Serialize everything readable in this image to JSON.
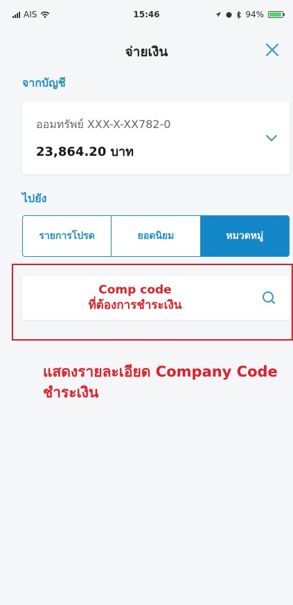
{
  "status_bar": {
    "carrier": "AIS",
    "time": "15:46",
    "battery": "94%",
    "battery_level": 0.94
  },
  "header": {
    "title": "จ่ายเงิน"
  },
  "from_section": {
    "label": "จากบัญชี",
    "account_name": "ออมทรัพย์ XXX-X-XX782-0",
    "balance": "23,864.20 บาท"
  },
  "to_section": {
    "label": "ไปยัง",
    "tabs": [
      {
        "label": "รายการโปรด",
        "active": false
      },
      {
        "label": "ยอดนิยม",
        "active": false
      },
      {
        "label": "หมวดหมู่",
        "active": true
      }
    ]
  },
  "search": {
    "placeholder_line1": "Comp code",
    "placeholder_line2": "ที่ต้องการชำระเงิน"
  },
  "annotation": {
    "text": "แสดงรายละเอียด Company Code ชำระเงิน"
  },
  "colors": {
    "accent": "#1a8fc9",
    "annotation_red": "#e41e26"
  }
}
